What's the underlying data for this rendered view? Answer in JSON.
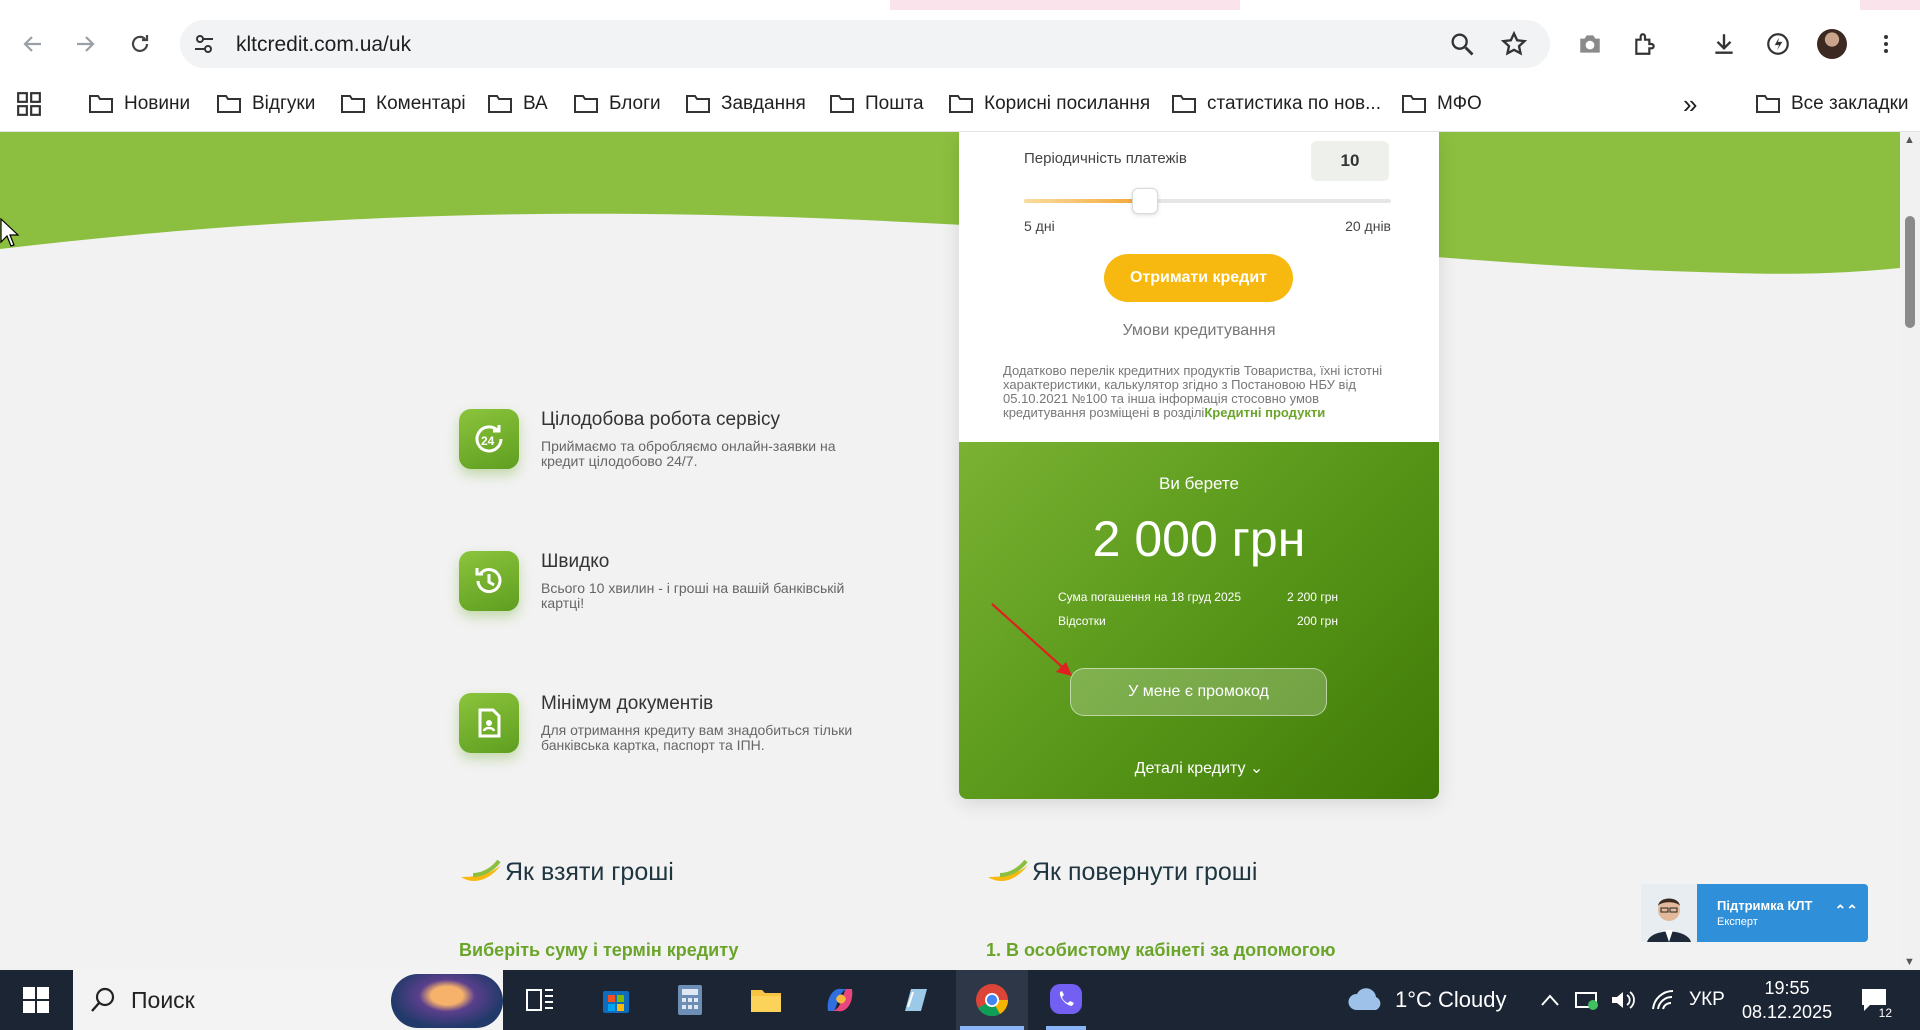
{
  "browser": {
    "url": "kltcredit.com.ua/uk",
    "bookmarks": [
      "Новини",
      "Відгуки",
      "Коментарі",
      "ВА",
      "Блоги",
      "Завдання",
      "Пошта",
      "Корисні посилання",
      "статистика по нов...",
      "МФО"
    ],
    "all_bookmarks": "Все закладки",
    "more": "»"
  },
  "features": [
    {
      "title": "Цілодобова робота сервісу",
      "desc": "Приймаємо та обробляємо онлайн-заявки на кредит цілодобово 24/7.",
      "icon": "clock-24-icon"
    },
    {
      "title": "Швидко",
      "desc": "Всього 10 хвилин - і гроші на вашій банківській картці!",
      "icon": "history-clock-icon"
    },
    {
      "title": "Мінімум документів",
      "desc": "Для отримання кредиту вам знадобиться тільки банківська картка, паспорт та ІПН.",
      "icon": "document-user-icon"
    }
  ],
  "calculator": {
    "period_label": "Періодичність платежів",
    "period_value": "10",
    "slider_fraction": 0.33,
    "slider_min": "5 дні",
    "slider_max": "20 днів",
    "get_credit": "Отримати кредит",
    "terms": "Умови кредитування",
    "note": "Додатково перелік кредитних продуктів Товариства, їхні істотні характеристики, калькулятор згідно з Постановою НБУ від 05.10.2021 №100 та інша інформація стосовно умов кредитування розміщені в розділі",
    "note_link": "Кредитні продукти"
  },
  "result": {
    "take_label": "Ви берете",
    "amount": "2 000 грн",
    "repay_label": "Сума погашення на 18 груд 2025",
    "repay_value": "2 200 грн",
    "interest_label": "Відсотки",
    "interest_value": "200 грн",
    "promo": "У мене є промокод",
    "details": "Деталі кредиту ⌄"
  },
  "sections": {
    "take_title": "Як взяти гроші",
    "take_sub": "Виберіть суму і термін кредиту",
    "return_title": "Як повернути гроші",
    "return_sub": "1. В особистому кабінеті за допомогою"
  },
  "support": {
    "title": "Підтримка КЛТ",
    "subtitle": "Експерт",
    "chevron": "⌃⌃"
  },
  "taskbar": {
    "search": "Поиск",
    "weather": "1°C  Cloudy",
    "lang": "УКР",
    "time": "19:55",
    "date": "08.12.2025",
    "notifications": "12"
  },
  "colors": {
    "brand_green": "#8cbf3f",
    "button_yellow": "#f7b90f",
    "support_blue": "#2f8fd8"
  }
}
